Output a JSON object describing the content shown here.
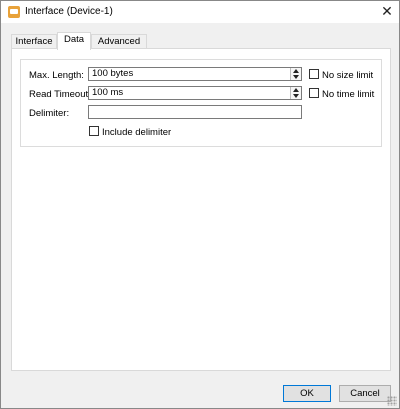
{
  "window": {
    "title": "Interface (Device-1)",
    "close_glyph": "✕"
  },
  "tabs": [
    {
      "label": "Interface",
      "active": false
    },
    {
      "label": "Data",
      "active": true
    },
    {
      "label": "Advanced",
      "active": false
    }
  ],
  "data_tab": {
    "max_length": {
      "label": "Max. Length:",
      "value": "100 bytes",
      "no_limit_label": "No size limit",
      "no_limit_checked": false
    },
    "read_timeout": {
      "label": "Read Timeout:",
      "value": "100 ms",
      "no_limit_label": "No time limit",
      "no_limit_checked": false
    },
    "delimiter": {
      "label": "Delimiter:",
      "value": ""
    },
    "include_delimiter": {
      "label": "Include delimiter",
      "checked": false
    }
  },
  "buttons": {
    "ok_label": "OK",
    "cancel_label": "Cancel"
  },
  "icons": {
    "app": "app-icon",
    "close": "close-icon",
    "spin_up": "arrow-up-icon",
    "spin_down": "arrow-down-icon",
    "grip": "resize-grip-icon"
  },
  "colors": {
    "window_bg": "#f0f0f0",
    "panel_bg": "#ffffff",
    "accent": "#0078d7",
    "app_icon": "#e8a23a"
  }
}
